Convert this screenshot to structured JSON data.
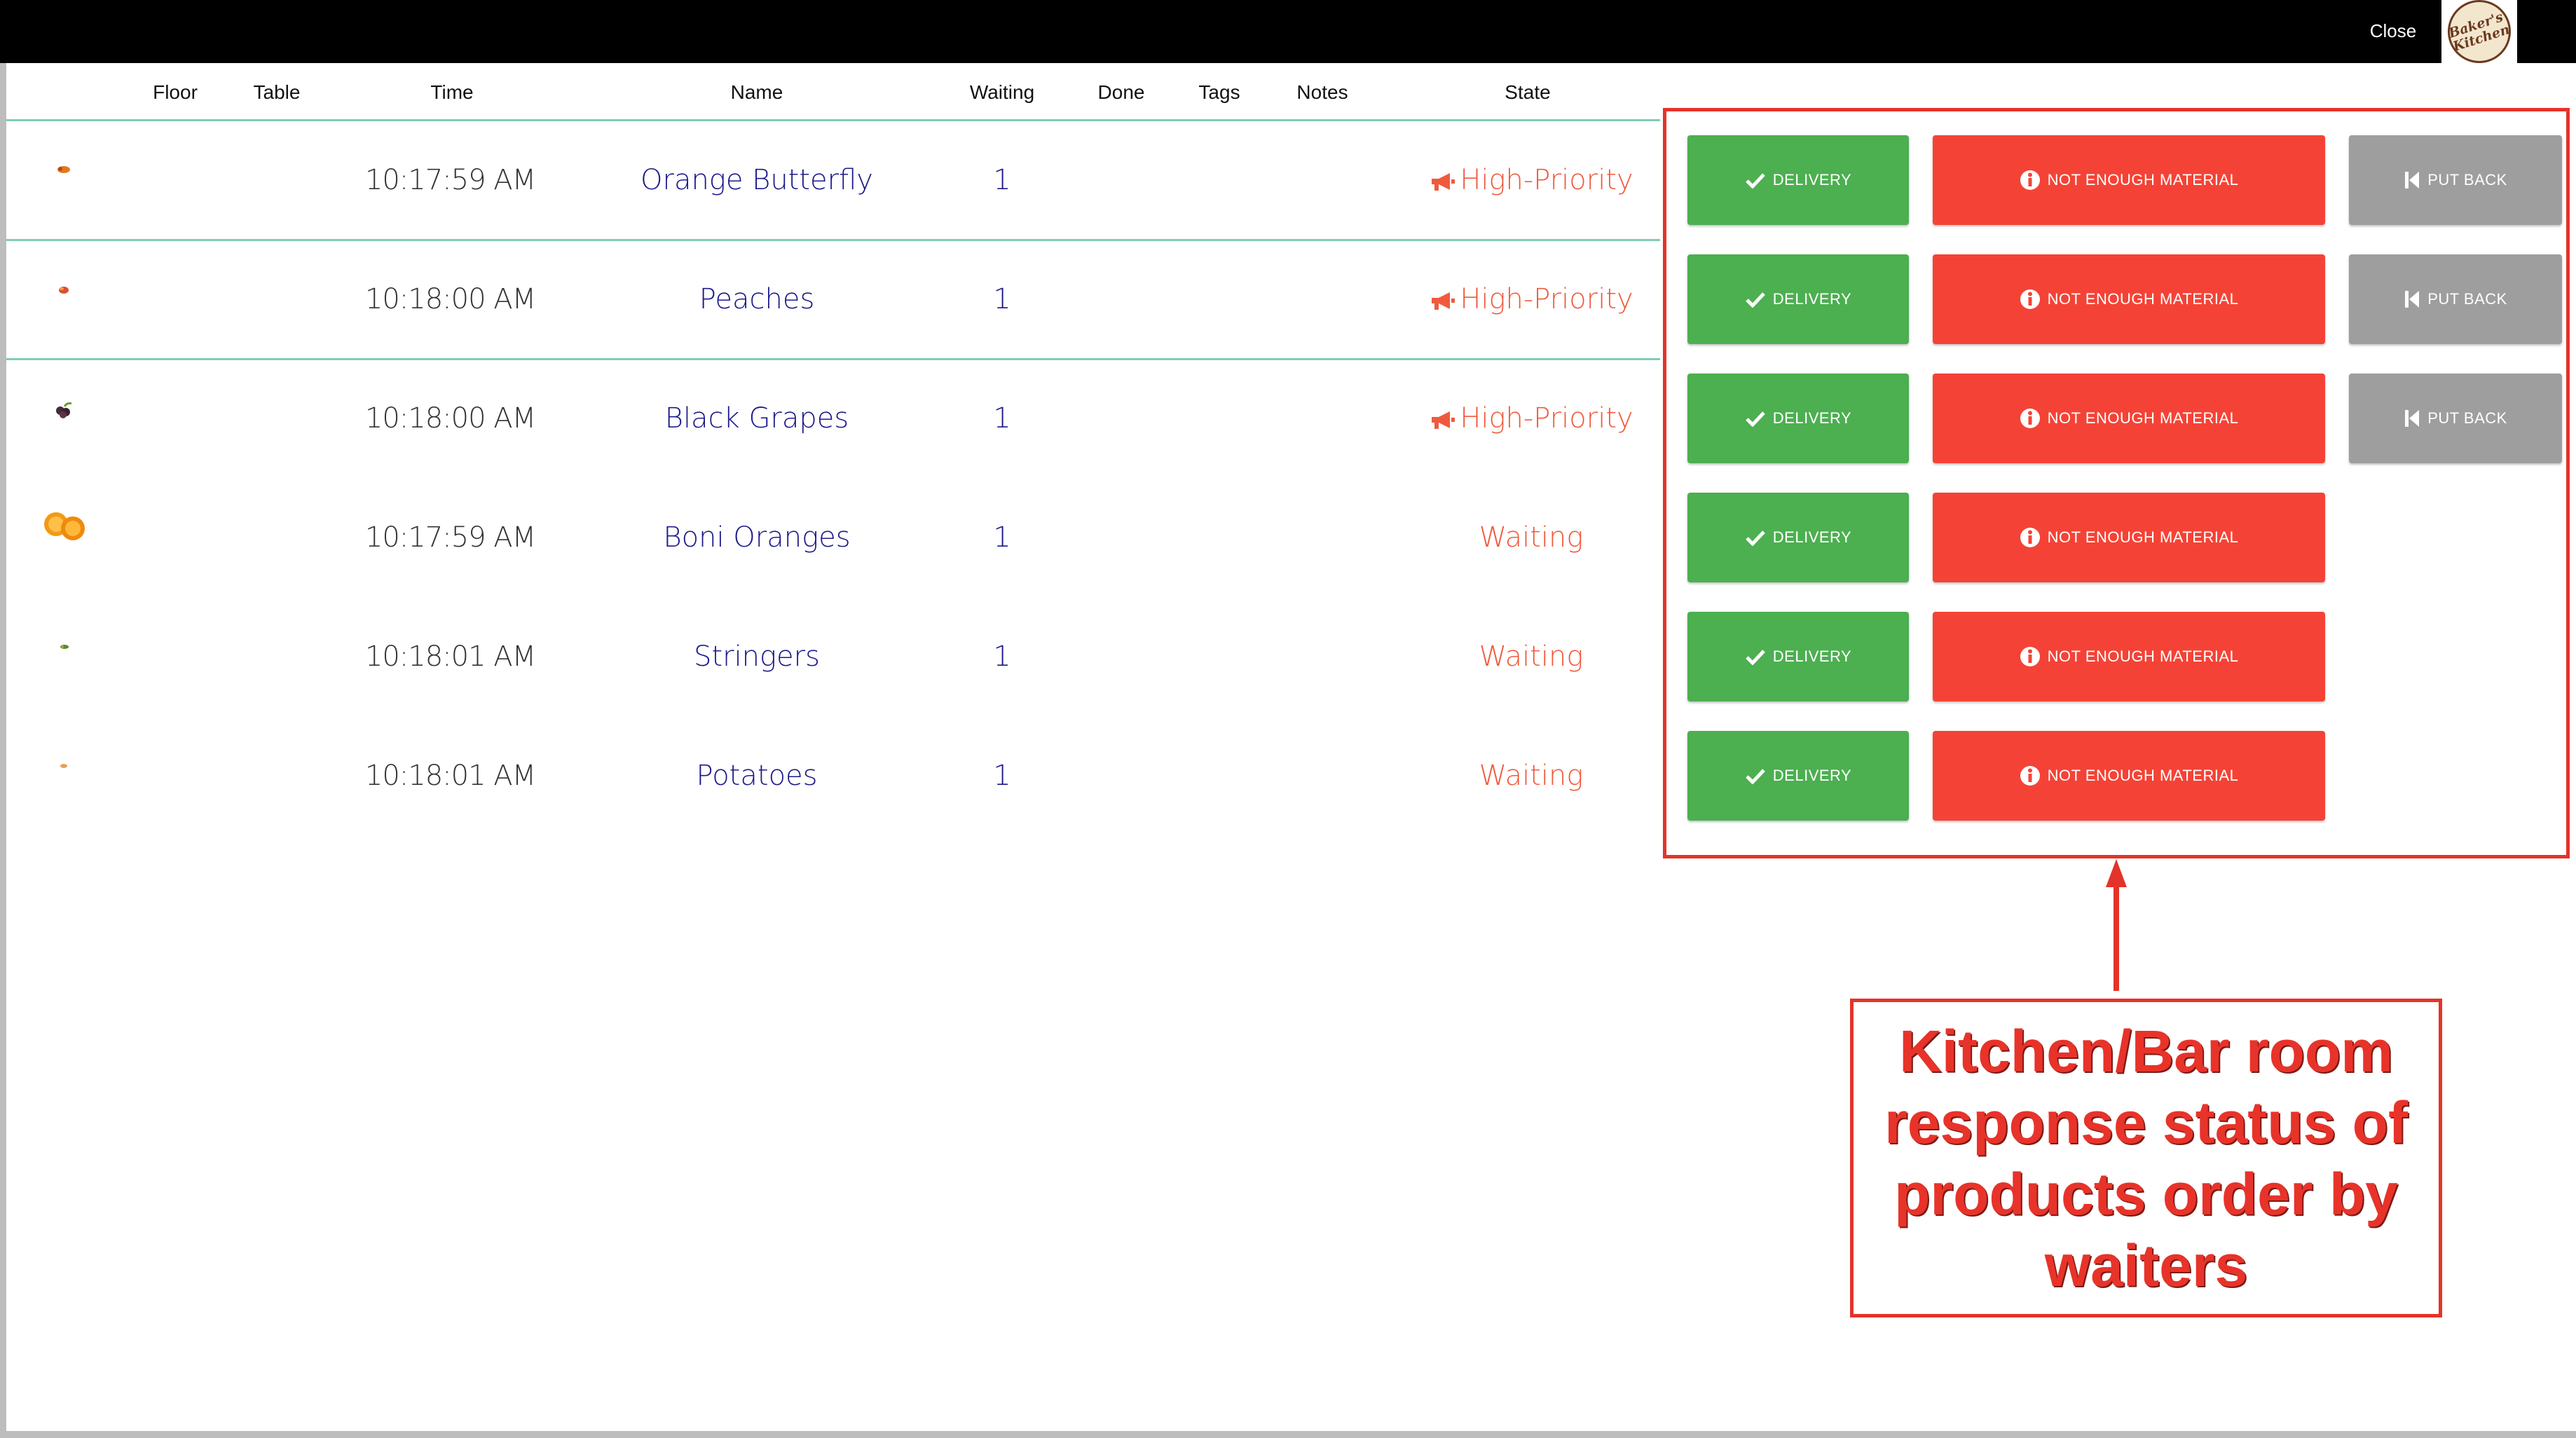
{
  "topbar": {
    "close_label": "Close",
    "logo_text": "Baker's Kitchen"
  },
  "table": {
    "columns": [
      "",
      "Floor",
      "Table",
      "Time",
      "Name",
      "Waiting",
      "Done",
      "Tags",
      "Notes",
      "State"
    ],
    "rows": [
      {
        "image": "orange-butterfly-thumbnail",
        "time": "10:17:59 AM",
        "name": "Orange Butterfly",
        "waiting": "1",
        "state": "High-Priority",
        "put_back": true
      },
      {
        "image": "peaches-thumbnail",
        "time": "10:18:00 AM",
        "name": "Peaches",
        "waiting": "1",
        "state": "High-Priority",
        "put_back": true
      },
      {
        "image": "black-grapes-thumbnail",
        "time": "10:18:00 AM",
        "name": "Black Grapes",
        "waiting": "1",
        "state": "High-Priority",
        "put_back": true
      },
      {
        "image": "boni-oranges-thumbnail",
        "time": "10:17:59 AM",
        "name": "Boni Oranges",
        "waiting": "1",
        "state": "Waiting",
        "put_back": false
      },
      {
        "image": "stringers-thumbnail",
        "time": "10:18:01 AM",
        "name": "Stringers",
        "waiting": "1",
        "state": "Waiting",
        "put_back": false
      },
      {
        "image": "potatoes-thumbnail",
        "time": "10:18:01 AM",
        "name": "Potatoes",
        "waiting": "1",
        "state": "Waiting",
        "put_back": false
      }
    ]
  },
  "actions": {
    "delivery_label": "DELIVERY",
    "not_enough_label": "NOT ENOUGH MATERIAL",
    "put_back_label": "PUT BACK"
  },
  "annotation": {
    "text": "Kitchen/Bar room response status of products order by waiters"
  },
  "colors": {
    "green": "#4caf50",
    "red": "#f44336",
    "gray": "#9e9e9e",
    "name_blue": "#1c1a8a",
    "state_orange": "#f05a3c",
    "row_line": "#7ecdb7",
    "callout_red": "#e4332a"
  }
}
